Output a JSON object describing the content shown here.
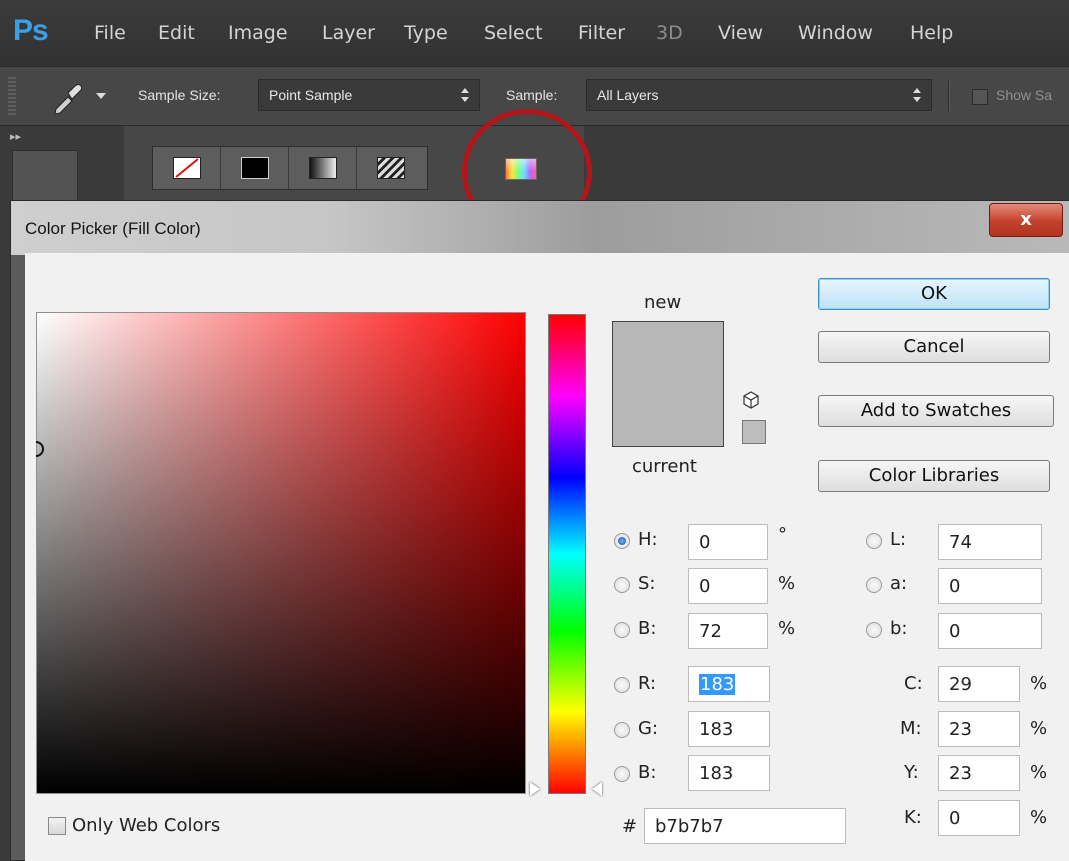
{
  "app": {
    "logo": "Ps",
    "menu": [
      "File",
      "Edit",
      "Image",
      "Layer",
      "Type",
      "Select",
      "Filter",
      "3D",
      "View",
      "Window",
      "Help"
    ]
  },
  "options_bar": {
    "tool_icon": "eyedropper-icon",
    "sample_size_label": "Sample Size:",
    "sample_size_value": "Point Sample",
    "sample_label": "Sample:",
    "sample_value": "All Layers",
    "show_sampling_label": "Show Sa"
  },
  "fill_bar": {
    "buttons": [
      "no-fill-icon",
      "solid-color-icon",
      "gradient-icon",
      "pattern-icon"
    ],
    "picker_icon": "color-picker-icon",
    "highlight_color": "#b3161a"
  },
  "dialog": {
    "title": "Color Picker (Fill Color)",
    "close_label": "x",
    "new_label": "new",
    "current_label": "current",
    "new_color": "#b7b7b7",
    "buttons": {
      "ok": "OK",
      "cancel": "Cancel",
      "add_to_swatches": "Add to Swatches",
      "color_libraries": "Color Libraries"
    },
    "hsb": {
      "h_label": "H:",
      "h_value": "0",
      "h_unit": "°",
      "s_label": "S:",
      "s_value": "0",
      "s_unit": "%",
      "b_label": "B:",
      "b_value": "72",
      "b_unit": "%"
    },
    "rgb": {
      "r_label": "R:",
      "r_value": "183",
      "g_label": "G:",
      "g_value": "183",
      "b_label": "B:",
      "b_value": "183"
    },
    "lab": {
      "l_label": "L:",
      "l_value": "74",
      "a_label": "a:",
      "a_value": "0",
      "b_label": "b:",
      "b_value": "0"
    },
    "cmyk": {
      "c_label": "C:",
      "c_value": "29",
      "c_unit": "%",
      "m_label": "M:",
      "m_value": "23",
      "m_unit": "%",
      "y_label": "Y:",
      "y_value": "23",
      "y_unit": "%",
      "k_label": "K:",
      "k_value": "0",
      "k_unit": "%"
    },
    "hex_label": "#",
    "hex_value": "b7b7b7",
    "only_web_colors_label": "Only Web Colors",
    "selected_mode": "H"
  }
}
